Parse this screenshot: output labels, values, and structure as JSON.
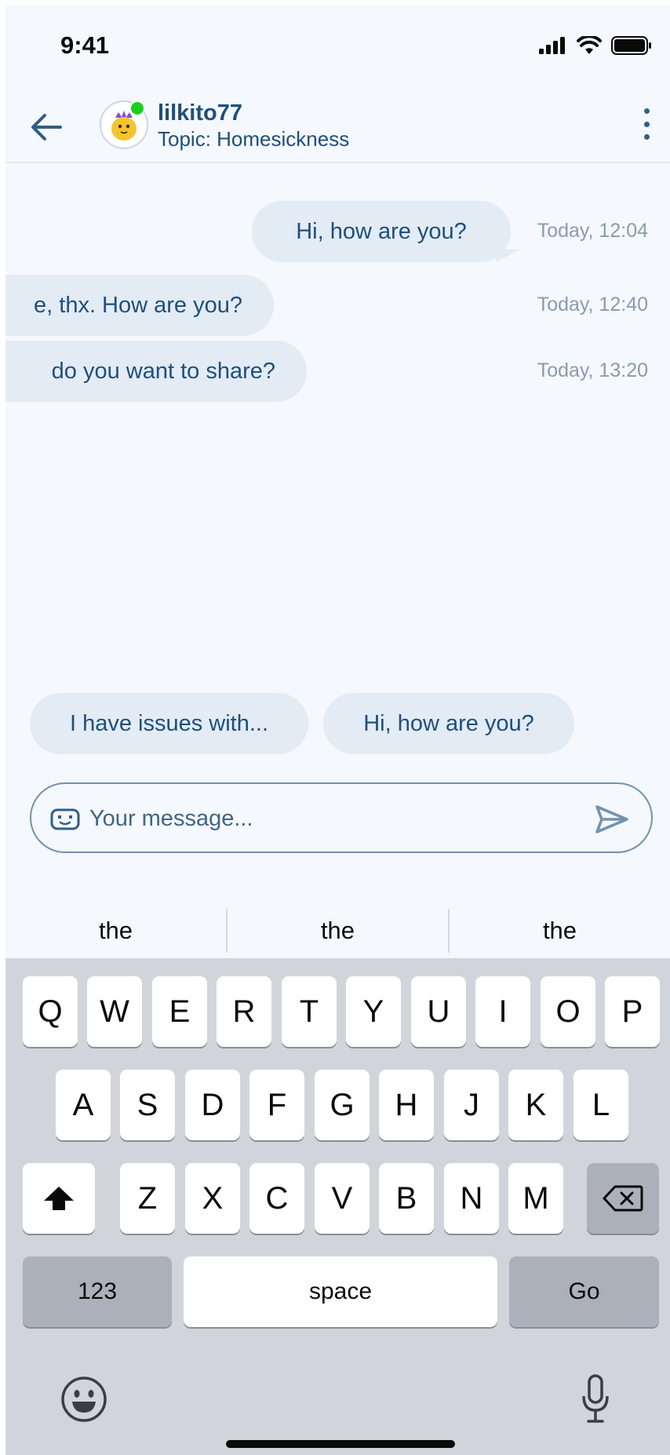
{
  "status_bar": {
    "time": "9:41"
  },
  "header": {
    "username": "lilkito77",
    "topic": "Topic: Homesickness"
  },
  "messages": [
    {
      "text": "Hi, how are you?",
      "time": "Today, 12:04",
      "direction": "outgoing"
    },
    {
      "text": "e, thx. How are you?",
      "time": "Today, 12:40",
      "direction": "incoming"
    },
    {
      "text": "do you want to share?",
      "time": "Today, 13:20",
      "direction": "incoming"
    }
  ],
  "quick_replies": [
    "I have issues with...",
    "Hi, how are you?"
  ],
  "composer": {
    "placeholder": "Your message..."
  },
  "keyboard": {
    "suggestions": [
      "the",
      "the",
      "the"
    ],
    "row1": [
      "Q",
      "W",
      "E",
      "R",
      "T",
      "Y",
      "U",
      "I",
      "O",
      "P"
    ],
    "row2": [
      "A",
      "S",
      "D",
      "F",
      "G",
      "H",
      "J",
      "K",
      "L"
    ],
    "row3": [
      "Z",
      "X",
      "C",
      "V",
      "B",
      "N",
      "M"
    ],
    "numbers_label": "123",
    "space_label": "space",
    "go_label": "Go"
  },
  "colors": {
    "accent": "#1f4f7a",
    "bubble": "#e3ebf5",
    "online": "#17d01c",
    "timestamp": "#8a9bb0"
  }
}
